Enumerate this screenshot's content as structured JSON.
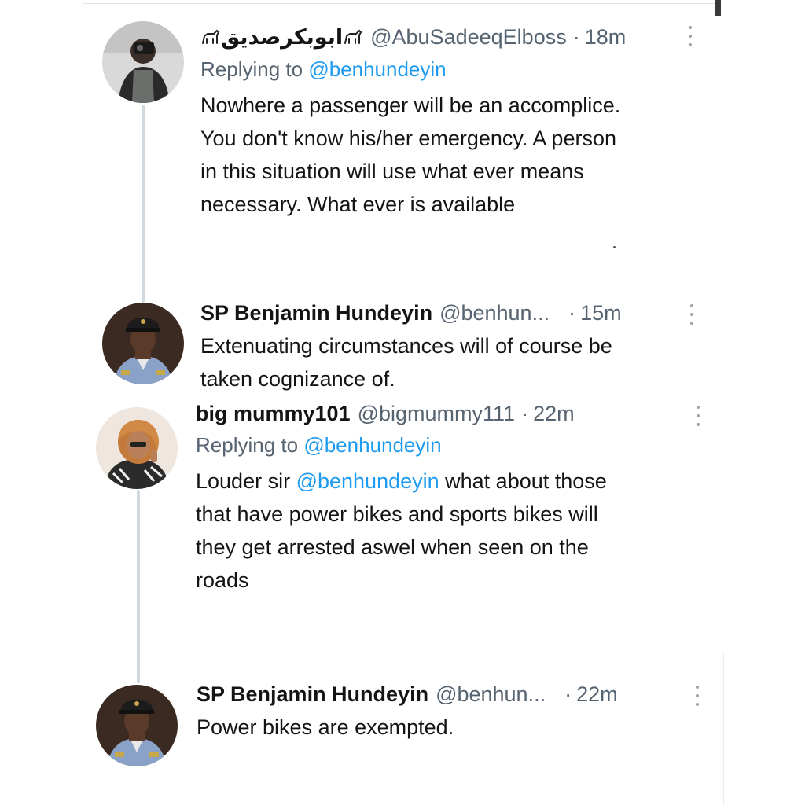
{
  "tweets": [
    {
      "name_prefix": "ابوبکرصدیق",
      "name_glyph_left": "goat-emoji",
      "name_glyph_right": "goat-emoji",
      "handle": "@AbuSadeeqElboss",
      "separator": "·",
      "time": "18m",
      "replying_prefix": "Replying to",
      "replying_to": "@benhundeyin",
      "body_lines": [
        "Nowhere a passenger will be an accomplice.",
        "You don't know his/her emergency. A person",
        "in this situation will use what ever means",
        "necessary.  What ever is available"
      ]
    },
    {
      "name": "SP Benjamin Hundeyin",
      "handle": "@benhun...",
      "separator": "·",
      "time": "15m",
      "body_lines": [
        "Extenuating circumstances will of course be",
        "taken cognizance of."
      ]
    },
    {
      "name": "big mummy101",
      "handle": "@bigmummy111",
      "separator": "·",
      "time": "22m",
      "replying_prefix": "Replying to",
      "replying_to": "@benhundeyin",
      "body_first_prefix": "Louder sir ",
      "body_first_mention": "@benhundeyin",
      "body_first_suffix": " what about those",
      "body_lines": [
        "that have power bikes and sports bikes will",
        "they get arrested aswel when seen on the",
        "roads"
      ]
    },
    {
      "name": "SP Benjamin Hundeyin",
      "handle": "@benhun...",
      "separator": "·",
      "time": "22m",
      "body_lines": [
        "Power bikes are exempted."
      ]
    }
  ],
  "colors": {
    "text": "#141414",
    "secondary": "#566370",
    "link": "#1d9bf0",
    "thread_line": "#cfd9de"
  }
}
